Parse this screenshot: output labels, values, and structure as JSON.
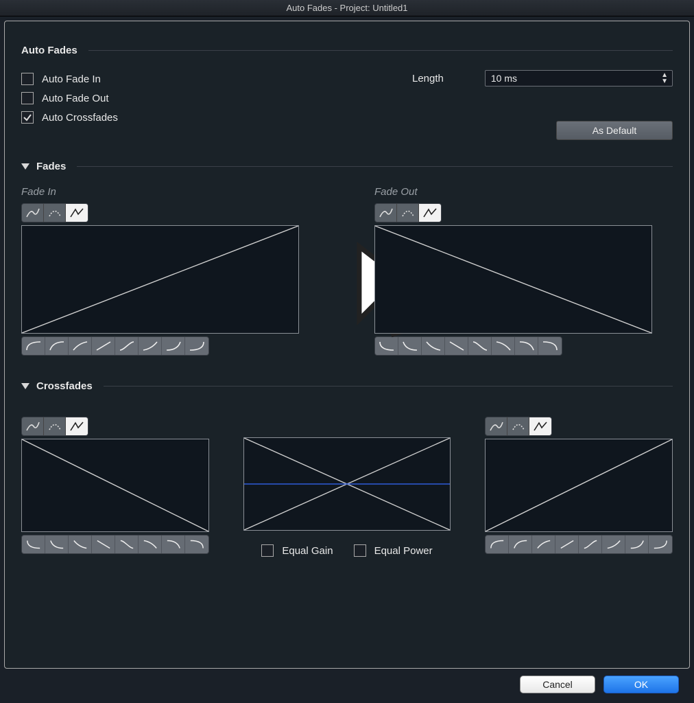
{
  "window": {
    "title": "Auto Fades - Project: Untitled1"
  },
  "sections": {
    "autofades": {
      "title": "Auto Fades",
      "opts": {
        "fade_in": {
          "label": "Auto Fade In",
          "checked": false
        },
        "fade_out": {
          "label": "Auto Fade Out",
          "checked": false
        },
        "crossfades": {
          "label": "Auto Crossfades",
          "checked": true
        }
      },
      "length": {
        "label": "Length",
        "value": "10 ms"
      },
      "as_default": "As Default"
    },
    "fades": {
      "title": "Fades",
      "in": {
        "label": "Fade In"
      },
      "out": {
        "label": "Fade Out"
      }
    },
    "crossfades": {
      "title": "Crossfades",
      "equal_gain": {
        "label": "Equal Gain",
        "checked": false
      },
      "equal_power": {
        "label": "Equal Power",
        "checked": false
      }
    }
  },
  "curve_tab_icons": [
    "spline-icon",
    "dotted-arc-icon",
    "linear-seg-icon"
  ],
  "shape_icons_in": [
    "curve1",
    "curve2",
    "curve3",
    "curve4",
    "curve5",
    "curve6",
    "curve7",
    "curve8"
  ],
  "shape_icons_out": [
    "curve1",
    "curve2",
    "curve3",
    "curve4",
    "curve5",
    "curve6",
    "curve7",
    "curve8"
  ],
  "buttons": {
    "cancel": "Cancel",
    "ok": "OK"
  },
  "colors": {
    "bg": "#1a2228",
    "canvas": "#0f161e",
    "line": "#cfcfcf",
    "accent": "#2f5bd8"
  }
}
